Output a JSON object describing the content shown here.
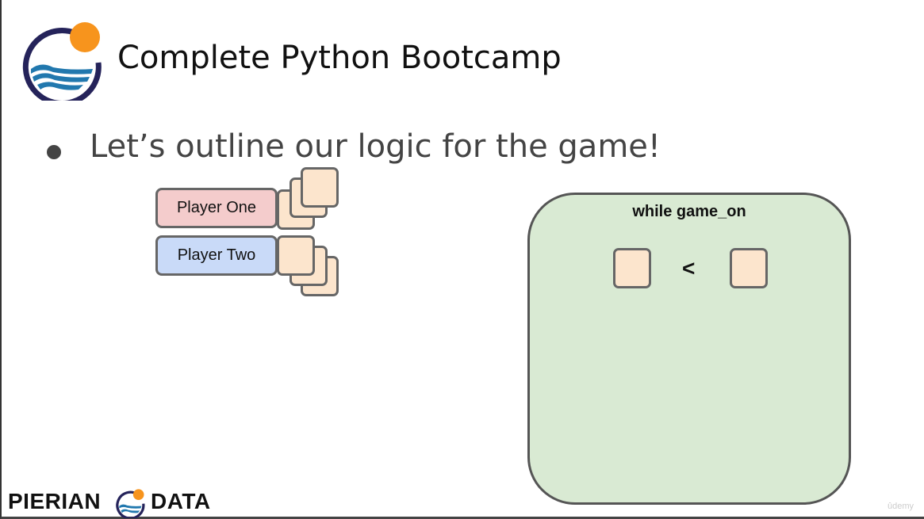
{
  "header": {
    "title": "Complete Python Bootcamp",
    "logo_colors": {
      "ring": "#25235a",
      "sun": "#f7941d",
      "waves": "#2178ae"
    }
  },
  "bullet": {
    "text": "Let’s outline our logic for the game!"
  },
  "players": [
    {
      "label": "Player One",
      "color": "#f4cccc"
    },
    {
      "label": "Player Two",
      "color": "#c9daf8"
    }
  ],
  "game": {
    "label": "while game_on",
    "comparison": "<",
    "color": "#d9ead3",
    "card_color": "#fce5cd"
  },
  "footer": {
    "brand_left": "PIERIAN",
    "brand_right": "DATA",
    "watermark": "ûdemy"
  }
}
